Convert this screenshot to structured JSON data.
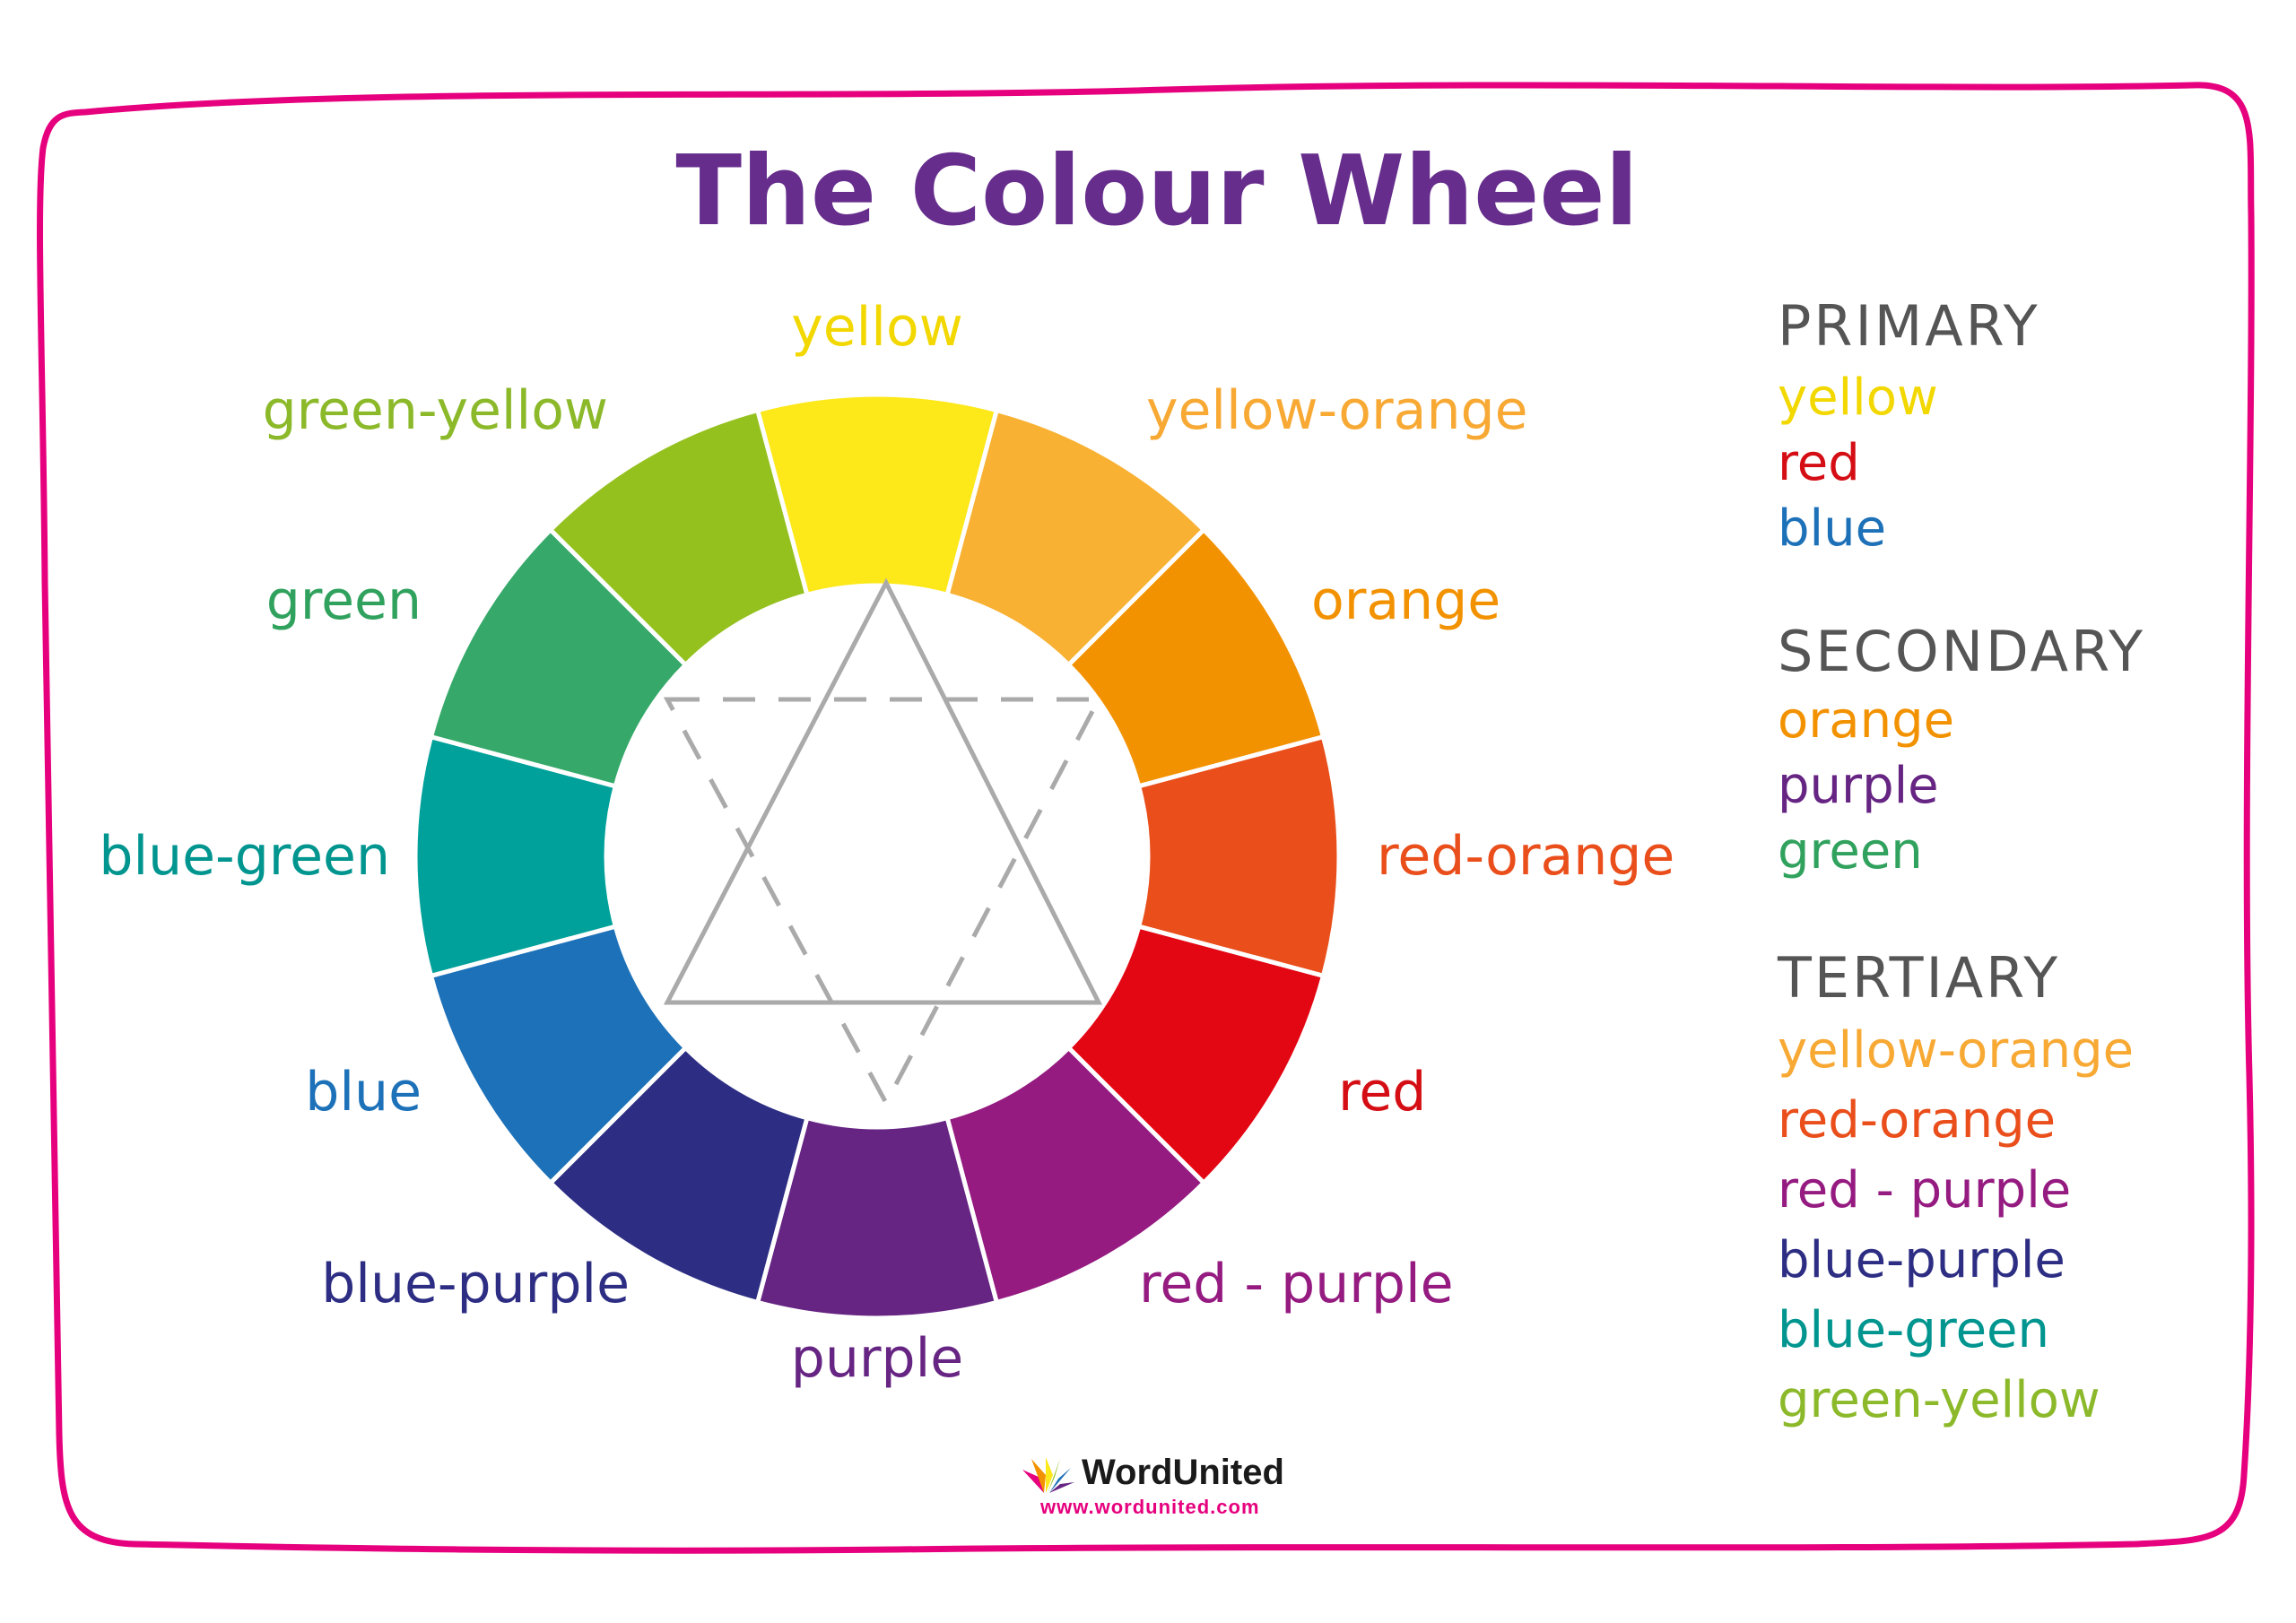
{
  "title": "The Colour Wheel",
  "colors": {
    "border": "#e6007e",
    "title": "#662d8c",
    "guide_lines": "#aaaaaa",
    "heading": "#555555"
  },
  "wheel": {
    "segments": [
      {
        "label": "yellow",
        "color": "#fde81a",
        "label_color": "#f2d800"
      },
      {
        "label": "yellow-orange",
        "color": "#f8b133",
        "label_color": "#f7a934"
      },
      {
        "label": "orange",
        "color": "#f39200",
        "label_color": "#f39200"
      },
      {
        "label": "red-orange",
        "color": "#e94e1b",
        "label_color": "#e94e1b"
      },
      {
        "label": "red",
        "color": "#e30613",
        "label_color": "#d40e14"
      },
      {
        "label": "red - purple",
        "color": "#951b81",
        "label_color": "#951b81"
      },
      {
        "label": "purple",
        "color": "#662483",
        "label_color": "#662483"
      },
      {
        "label": "blue-purple",
        "color": "#2d2e83",
        "label_color": "#2d2e83"
      },
      {
        "label": "blue",
        "color": "#1d71b8",
        "label_color": "#1d71b8"
      },
      {
        "label": "blue-green",
        "color": "#00a19a",
        "label_color": "#00958f"
      },
      {
        "label": "green",
        "color": "#36a96a",
        "label_color": "#30a25e"
      },
      {
        "label": "green-yellow",
        "color": "#95c11f",
        "label_color": "#8cb92a"
      }
    ]
  },
  "legend": {
    "groups": [
      {
        "heading": "PRIMARY",
        "items": [
          {
            "label": "yellow",
            "color": "#f2d800"
          },
          {
            "label": "red",
            "color": "#d40e14"
          },
          {
            "label": "blue",
            "color": "#1d71b8"
          }
        ]
      },
      {
        "heading": "SECONDARY",
        "items": [
          {
            "label": "orange",
            "color": "#f39200"
          },
          {
            "label": "purple",
            "color": "#662483"
          },
          {
            "label": "green",
            "color": "#30a25e"
          }
        ]
      },
      {
        "heading": "TERTIARY",
        "items": [
          {
            "label": "yellow-orange",
            "color": "#f7a934"
          },
          {
            "label": "red-orange",
            "color": "#e94e1b"
          },
          {
            "label": "red - purple",
            "color": "#951b81"
          },
          {
            "label": "blue-purple",
            "color": "#2d2e83"
          },
          {
            "label": "blue-green",
            "color": "#00958f"
          },
          {
            "label": "green-yellow",
            "color": "#8cb92a"
          }
        ]
      }
    ]
  },
  "brand": {
    "name": "WordUnited",
    "url": "www.wordunited.com",
    "logo_icon": "book-fan-icon"
  }
}
